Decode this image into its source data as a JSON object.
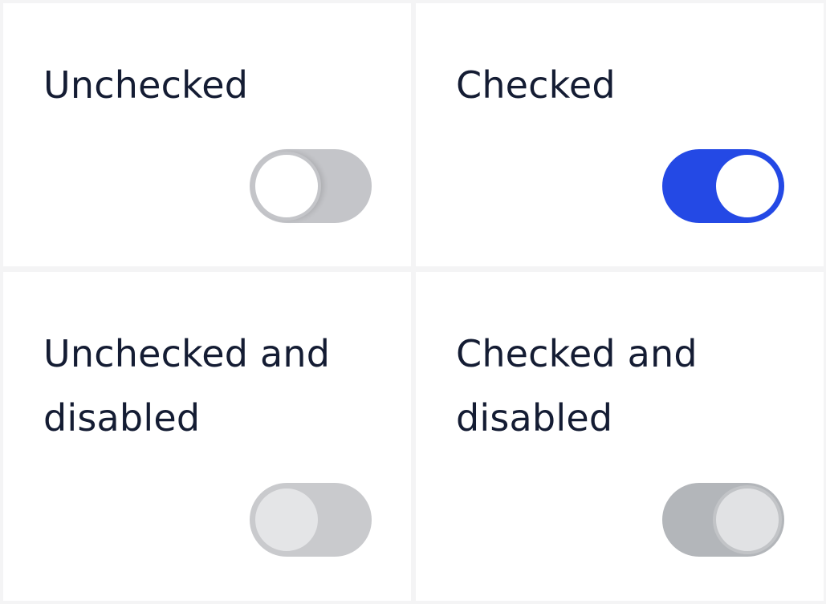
{
  "switches": [
    {
      "label": "Unchecked",
      "checked": false,
      "disabled": false
    },
    {
      "label": "Checked",
      "checked": true,
      "disabled": false
    },
    {
      "label": "Unchecked and disabled",
      "checked": false,
      "disabled": true
    },
    {
      "label": "Checked and disabled",
      "checked": true,
      "disabled": true
    }
  ],
  "colors": {
    "accent": "#2449e5",
    "track_off": "#c4c5c9",
    "track_disabled_off": "#c9cacd",
    "track_disabled_on": "#b3b6ba",
    "text": "#141c33",
    "background": "#ffffff"
  }
}
